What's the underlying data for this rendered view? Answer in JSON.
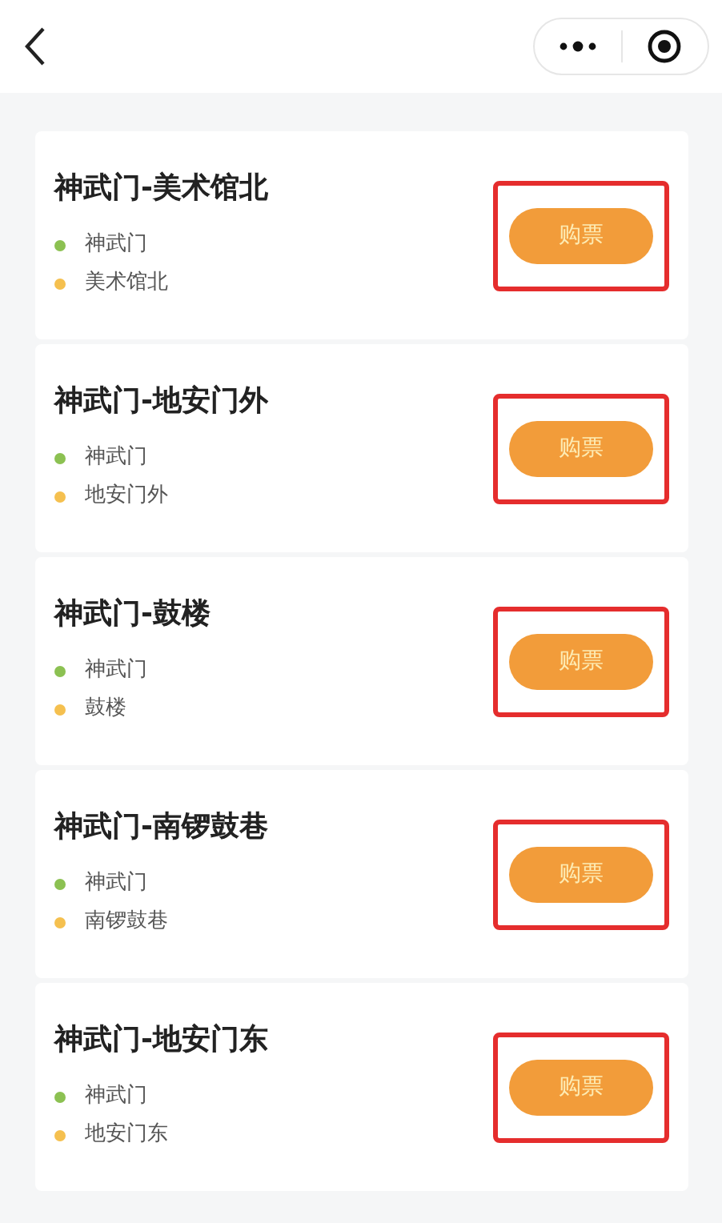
{
  "routes": [
    {
      "title": "神武门-美术馆北",
      "stops": [
        {
          "name": "神武门",
          "color": "#8cc152"
        },
        {
          "name": "美术馆北",
          "color": "#f5c04f"
        }
      ],
      "button": "购票",
      "highlighted": true
    },
    {
      "title": "神武门-地安门外",
      "stops": [
        {
          "name": "神武门",
          "color": "#8cc152"
        },
        {
          "name": "地安门外",
          "color": "#f5c04f"
        }
      ],
      "button": "购票",
      "highlighted": true
    },
    {
      "title": "神武门-鼓楼",
      "stops": [
        {
          "name": "神武门",
          "color": "#8cc152"
        },
        {
          "name": "鼓楼",
          "color": "#f5c04f"
        }
      ],
      "button": "购票",
      "highlighted": true
    },
    {
      "title": "神武门-南锣鼓巷",
      "stops": [
        {
          "name": "神武门",
          "color": "#8cc152"
        },
        {
          "name": "南锣鼓巷",
          "color": "#f5c04f"
        }
      ],
      "button": "购票",
      "highlighted": true
    },
    {
      "title": "神武门-地安门东",
      "stops": [
        {
          "name": "神武门",
          "color": "#8cc152"
        },
        {
          "name": "地安门东",
          "color": "#f5c04f"
        }
      ],
      "button": "购票",
      "highlighted": true
    }
  ]
}
